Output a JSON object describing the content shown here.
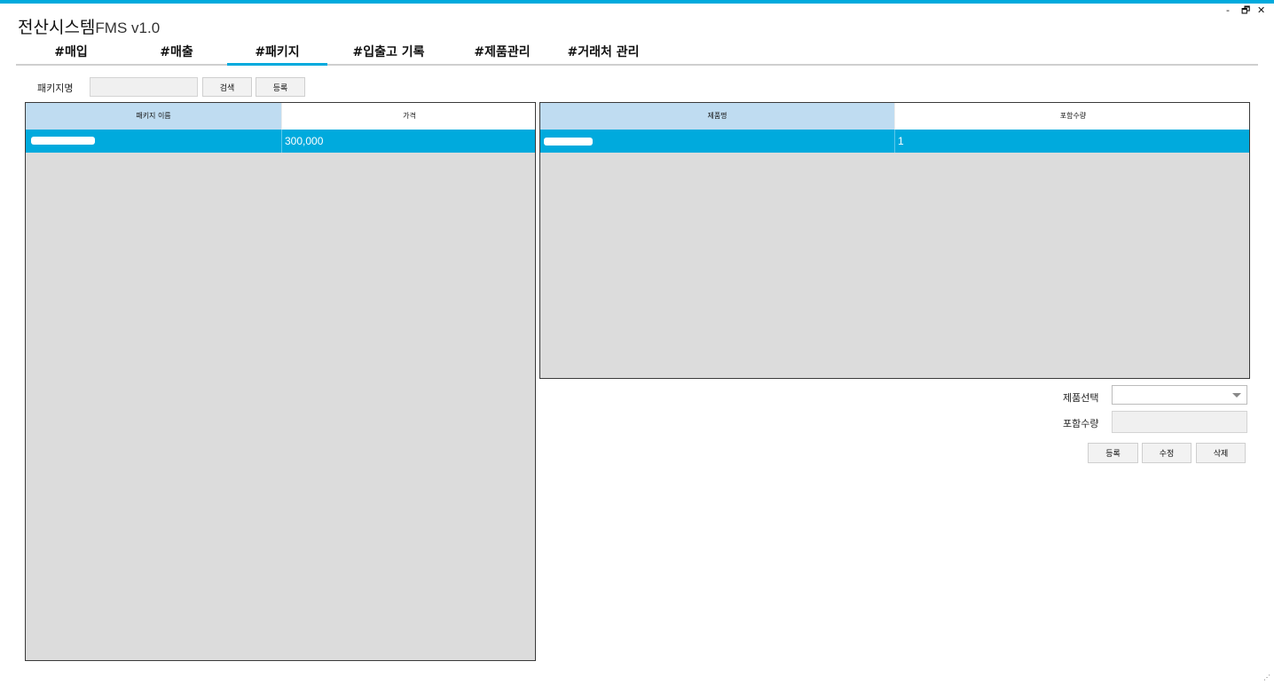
{
  "app": {
    "title_main": "전산시스템",
    "title_sub": "FMS v1.0",
    "accent_color": "#00aadd",
    "window_controls": {
      "minimize": "-",
      "restore": "🗗",
      "close": "✕"
    }
  },
  "tabs": [
    {
      "label": "#매입",
      "active": false
    },
    {
      "label": "#매출",
      "active": false
    },
    {
      "label": "#패키지",
      "active": true
    },
    {
      "label": "#입출고 기록",
      "active": false
    },
    {
      "label": "#제품관리",
      "active": false
    },
    {
      "label": "#거래처 관리",
      "active": false
    }
  ],
  "search": {
    "label": "패키지명",
    "value": "",
    "search_button": "검색",
    "register_button": "등록"
  },
  "package_table": {
    "columns": [
      "패키지 이름",
      "가격"
    ],
    "rows": [
      {
        "name": "",
        "price": "300,000"
      }
    ]
  },
  "product_table": {
    "columns": [
      "제품명",
      "포함수량"
    ],
    "rows": [
      {
        "name": "",
        "quantity": "1"
      }
    ]
  },
  "form": {
    "product_select_label": "제품선택",
    "product_select_value": "",
    "quantity_label": "포함수량",
    "quantity_value": "",
    "register_button": "등록",
    "edit_button": "수정",
    "delete_button": "삭제"
  }
}
